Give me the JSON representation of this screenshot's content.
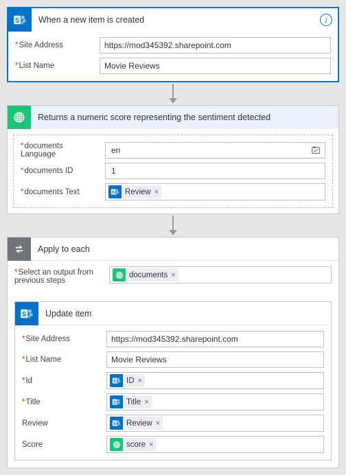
{
  "trigger": {
    "title": "When a new item is created",
    "fields": {
      "siteAddress": {
        "label": "Site Address",
        "value": "https://mod345392.sharepoint.com"
      },
      "listName": {
        "label": "List Name",
        "value": "Movie Reviews"
      }
    }
  },
  "sentiment": {
    "title": "Returns a numeric score representing the sentiment detected",
    "fields": {
      "language": {
        "label": "documents Language",
        "value": "en"
      },
      "id": {
        "label": "documents ID",
        "value": "1"
      },
      "text": {
        "label": "documents Text"
      }
    },
    "tokens": {
      "review": {
        "label": "Review",
        "source": "sp"
      }
    }
  },
  "apply": {
    "title": "Apply to each",
    "selectLabel": "Select an output from previous steps",
    "tokens": {
      "documents": {
        "label": "documents",
        "source": "sentiment"
      }
    }
  },
  "update": {
    "title": "Update item",
    "fields": {
      "siteAddress": {
        "label": "Site Address",
        "value": "https://mod345392.sharepoint.com"
      },
      "listName": {
        "label": "List Name",
        "value": "Movie Reviews"
      },
      "id": {
        "label": "Id"
      },
      "title": {
        "label": "Title"
      },
      "review": {
        "label": "Review"
      },
      "score": {
        "label": "Score"
      }
    },
    "tokens": {
      "id": {
        "label": "ID",
        "source": "sp"
      },
      "title": {
        "label": "Title",
        "source": "sp"
      },
      "review": {
        "label": "Review",
        "source": "sp"
      },
      "score": {
        "label": "score",
        "source": "sentiment"
      }
    }
  }
}
